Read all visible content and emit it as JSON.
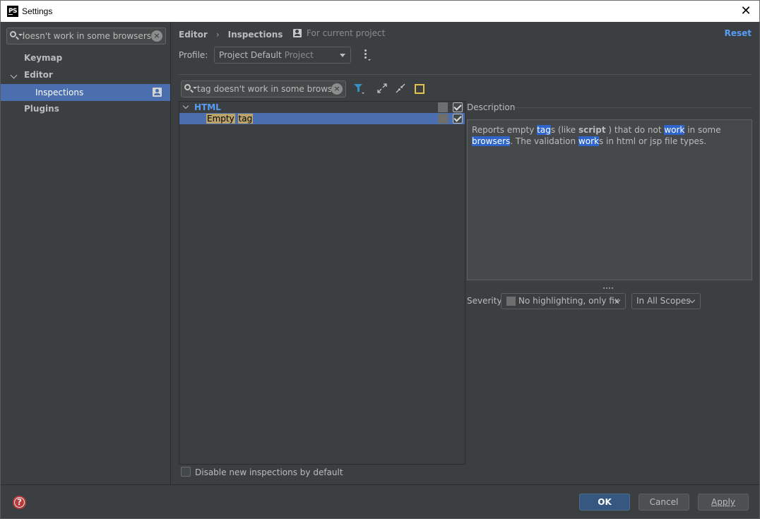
{
  "window": {
    "app_icon_text": "PS",
    "title": "Settings",
    "close_glyph": "✕"
  },
  "sidebar": {
    "search_value": "tag doesn't work in some browsers",
    "items": [
      {
        "label": "Keymap"
      },
      {
        "label": "Editor"
      },
      {
        "label": "Inspections"
      },
      {
        "label": "Plugins"
      }
    ]
  },
  "header": {
    "breadcrumb": [
      "Editor",
      "Inspections"
    ],
    "breadcrumb_sep": "›",
    "for_project": "For current project",
    "reset": "Reset"
  },
  "profile": {
    "label": "Profile:",
    "value": "Project Default",
    "scope": "Project"
  },
  "filter": {
    "search_value": "tag doesn't work in some browsers"
  },
  "inspections": {
    "group_label": "HTML",
    "item_word1": "Empty",
    "item_word2": "tag",
    "group_checked": true,
    "item_checked": true
  },
  "description": {
    "title": "Description",
    "parts": [
      "Reports empty ",
      "tag",
      "s (like ",
      "script",
      " ) that do not ",
      "work",
      " in some ",
      "browsers",
      ". The validation ",
      "work",
      "s in html or jsp file types."
    ]
  },
  "severity": {
    "label": "Severity:",
    "value": "No highlighting, only fix",
    "scope": "In All Scopes"
  },
  "options": {
    "disable_new_label": "Disable new inspections by default",
    "disable_new_checked": false
  },
  "buttons": {
    "help": "?",
    "ok": "OK",
    "cancel": "Cancel",
    "apply": "Apply"
  },
  "colors": {
    "background": "#3c3f41",
    "selection": "#4b6eaf",
    "link": "#589df6",
    "ok_button": "#365880",
    "search_highlight": "#bba36a",
    "desc_highlight": "#2f65ca"
  }
}
